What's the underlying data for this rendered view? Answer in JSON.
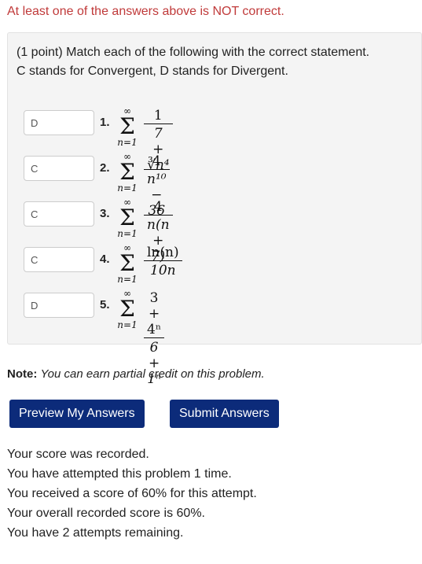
{
  "alert": "At least one of the answers above is NOT correct.",
  "problem": {
    "prompt_line1": "(1 point) Match each of the following with the correct statement.",
    "prompt_line2": "C stands for Convergent, D stands for Divergent.",
    "items": [
      {
        "number": "1.",
        "answer": "D",
        "sum_top": "∞",
        "sum_bottom": "n=1",
        "numerator": "1",
        "denominator": "7 + ∛n⁴"
      },
      {
        "number": "2.",
        "answer": "C",
        "sum_top": "∞",
        "sum_bottom": "n=1",
        "numerator": "4",
        "denominator": "n¹⁰ − 36"
      },
      {
        "number": "3.",
        "answer": "C",
        "sum_top": "∞",
        "sum_bottom": "n=1",
        "numerator": "4",
        "denominator": "n(n + 7)"
      },
      {
        "number": "4.",
        "answer": "C",
        "sum_top": "∞",
        "sum_bottom": "n=1",
        "numerator": "ln(n)",
        "denominator": "10n"
      },
      {
        "number": "5.",
        "answer": "D",
        "sum_top": "∞",
        "sum_bottom": "n=1",
        "numerator": "3 + 4ⁿ",
        "denominator": "6 + 1ⁿ"
      }
    ]
  },
  "note": {
    "label": "Note:",
    "text": "You can earn partial credit on this problem."
  },
  "buttons": {
    "preview": "Preview My Answers",
    "submit": "Submit Answers"
  },
  "status": [
    "Your score was recorded.",
    "You have attempted this problem 1 time.",
    "You received a score of 60% for this attempt.",
    "Your overall recorded score is 60%.",
    "You have 2 attempts remaining."
  ]
}
